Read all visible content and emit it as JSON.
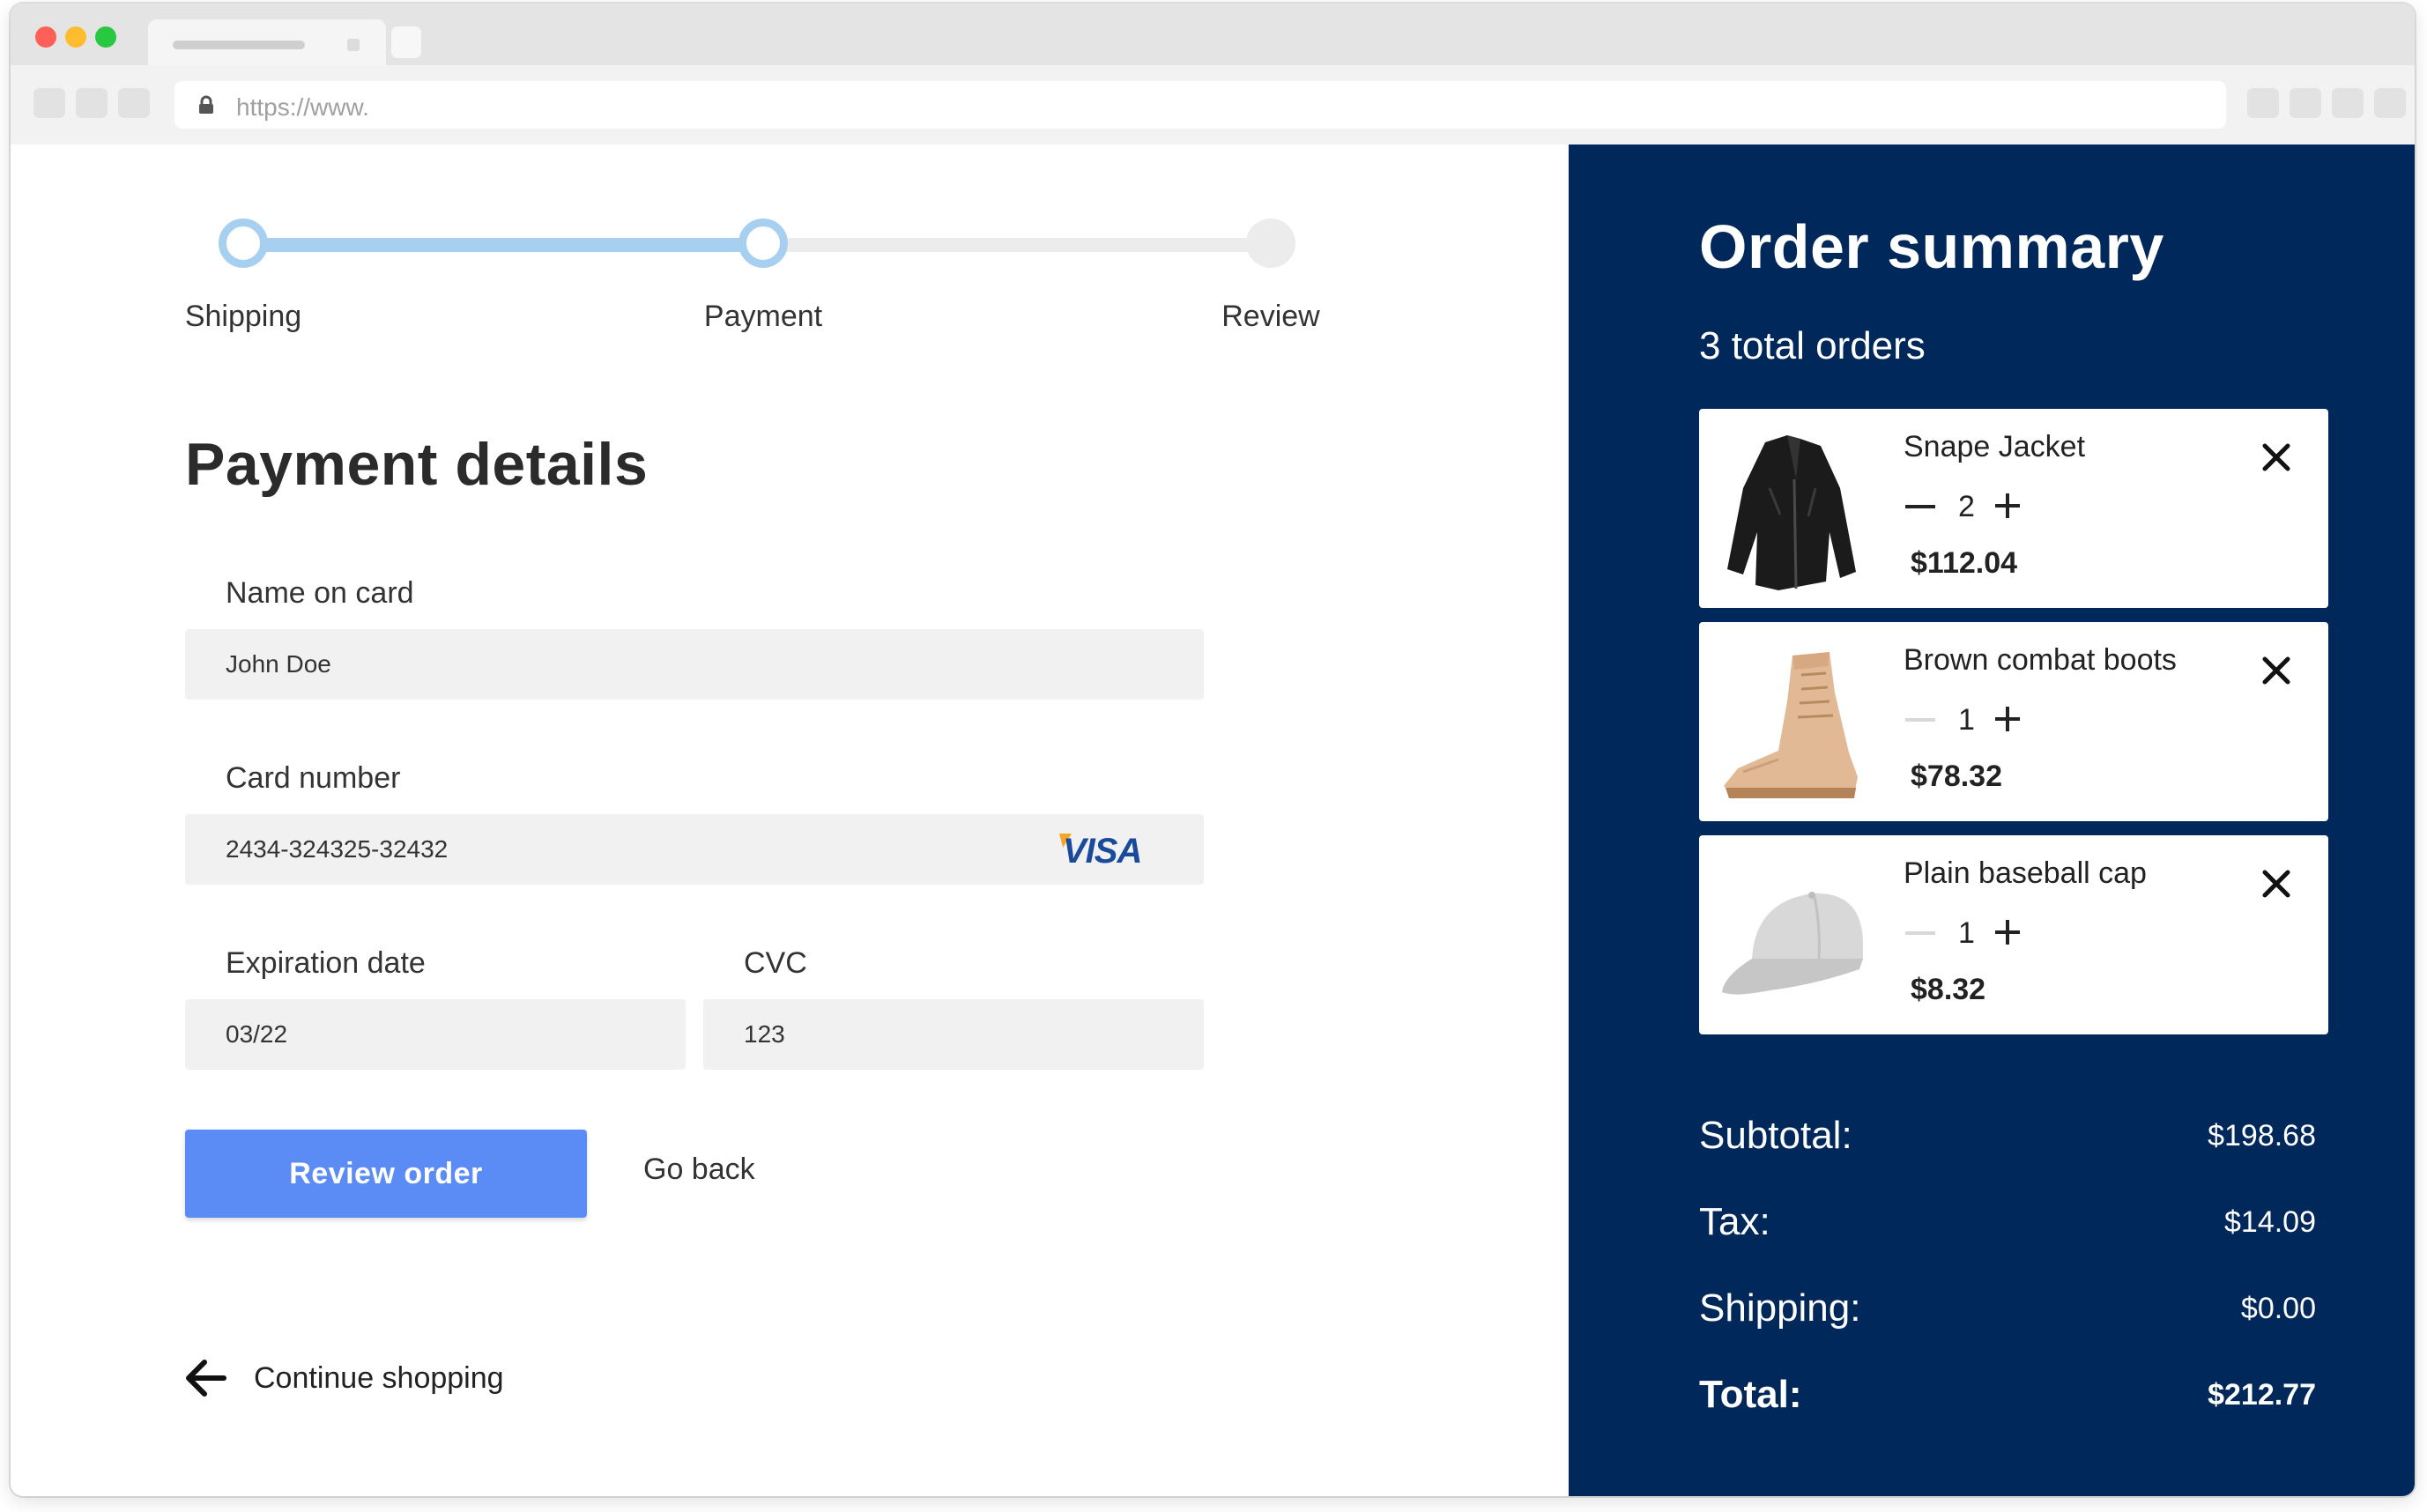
{
  "browser": {
    "url": "https://www."
  },
  "stepper": {
    "steps": [
      {
        "label": "Shipping",
        "state": "done"
      },
      {
        "label": "Payment",
        "state": "active"
      },
      {
        "label": "Review",
        "state": "pending"
      }
    ]
  },
  "form": {
    "title": "Payment details",
    "name_label": "Name on card",
    "name_value": "John Doe",
    "card_label": "Card number",
    "card_value": "2434-324325-32432",
    "card_brand": "VISA",
    "exp_label": "Expiration date",
    "exp_value": "03/22",
    "cvc_label": "CVC",
    "cvc_value": "123",
    "primary_button": "Review order",
    "secondary_button": "Go back",
    "continue_link": "Continue shopping"
  },
  "summary": {
    "title": "Order summary",
    "count_text": "3  total orders",
    "items": [
      {
        "name": "Snape Jacket",
        "qty": "2",
        "price": "$112.04",
        "image": "leather-jacket"
      },
      {
        "name": "Brown combat boots",
        "qty": "1",
        "price": "$78.32",
        "image": "combat-boots"
      },
      {
        "name": "Plain baseball cap",
        "qty": "1",
        "price": "$8.32",
        "image": "baseball-cap"
      }
    ],
    "subtotal_label": "Subtotal:",
    "subtotal_value": "$198.68",
    "tax_label": "Tax:",
    "tax_value": "$14.09",
    "shipping_label": "Shipping:",
    "shipping_value": "$0.00",
    "total_label": "Total:",
    "total_value": "$212.77"
  },
  "colors": {
    "primary": "#5b8cf5",
    "panel": "#00285a",
    "stepper_active": "#a6cff0",
    "field_bg": "#f1f1f1"
  }
}
